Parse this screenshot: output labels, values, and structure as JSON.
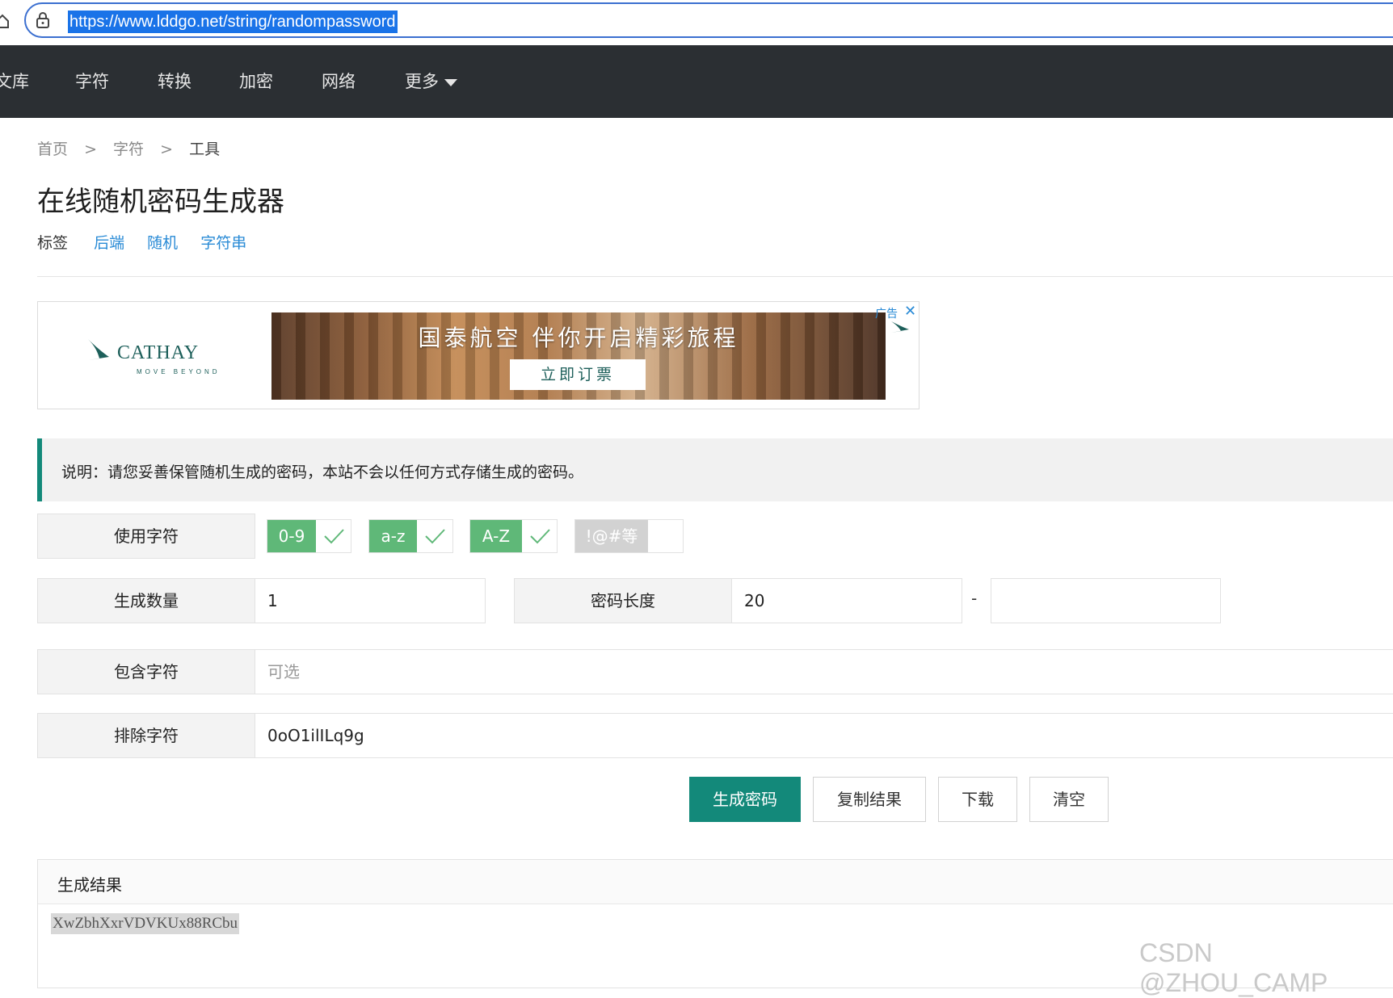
{
  "browser": {
    "url": "https://www.lddgo.net/string/randompassword"
  },
  "nav": {
    "items": [
      "文库",
      "字符",
      "转换",
      "加密",
      "网络",
      "更多"
    ]
  },
  "breadcrumb": {
    "home": "首页",
    "sep": ">",
    "category": "字符",
    "current": "工具"
  },
  "page": {
    "title": "在线随机密码生成器",
    "tags_label": "标签",
    "tags": [
      "后端",
      "随机",
      "字符串"
    ]
  },
  "ad": {
    "brand": "CATHAY",
    "tagline": "MOVE BEYOND",
    "headline": "国泰航空 伴你开启精彩旅程",
    "cta": "立即订票",
    "ad_mark": "广告",
    "close": "✕",
    "brand_color": "#1d5f5a"
  },
  "notice": {
    "text": "说明：请您妥善保管随机生成的密码，本站不会以任何方式存储生成的密码。"
  },
  "form": {
    "charset_label": "使用字符",
    "charsets": [
      {
        "label": "0-9",
        "checked": true
      },
      {
        "label": "a-z",
        "checked": true
      },
      {
        "label": "A-Z",
        "checked": true
      },
      {
        "label": "!@#等",
        "checked": false
      }
    ],
    "count_label": "生成数量",
    "count_value": "1",
    "length_label": "密码长度",
    "length_min": "20",
    "length_sep": "-",
    "length_max": "",
    "include_label": "包含字符",
    "include_placeholder": "可选",
    "exclude_label": "排除字符",
    "exclude_value": "0oO1ilILq9g"
  },
  "buttons": {
    "generate": "生成密码",
    "copy": "复制结果",
    "download": "下载",
    "clear": "清空"
  },
  "result": {
    "title": "生成结果",
    "value": "XwZbhXxrVDVKUx88RCbu"
  },
  "watermark": "CSDN @ZHOU_CAMP",
  "colors": {
    "nav_bg": "#2b2f33",
    "accent": "#13897a",
    "check_green": "#5fb878",
    "link_blue": "#2a8bd6"
  }
}
